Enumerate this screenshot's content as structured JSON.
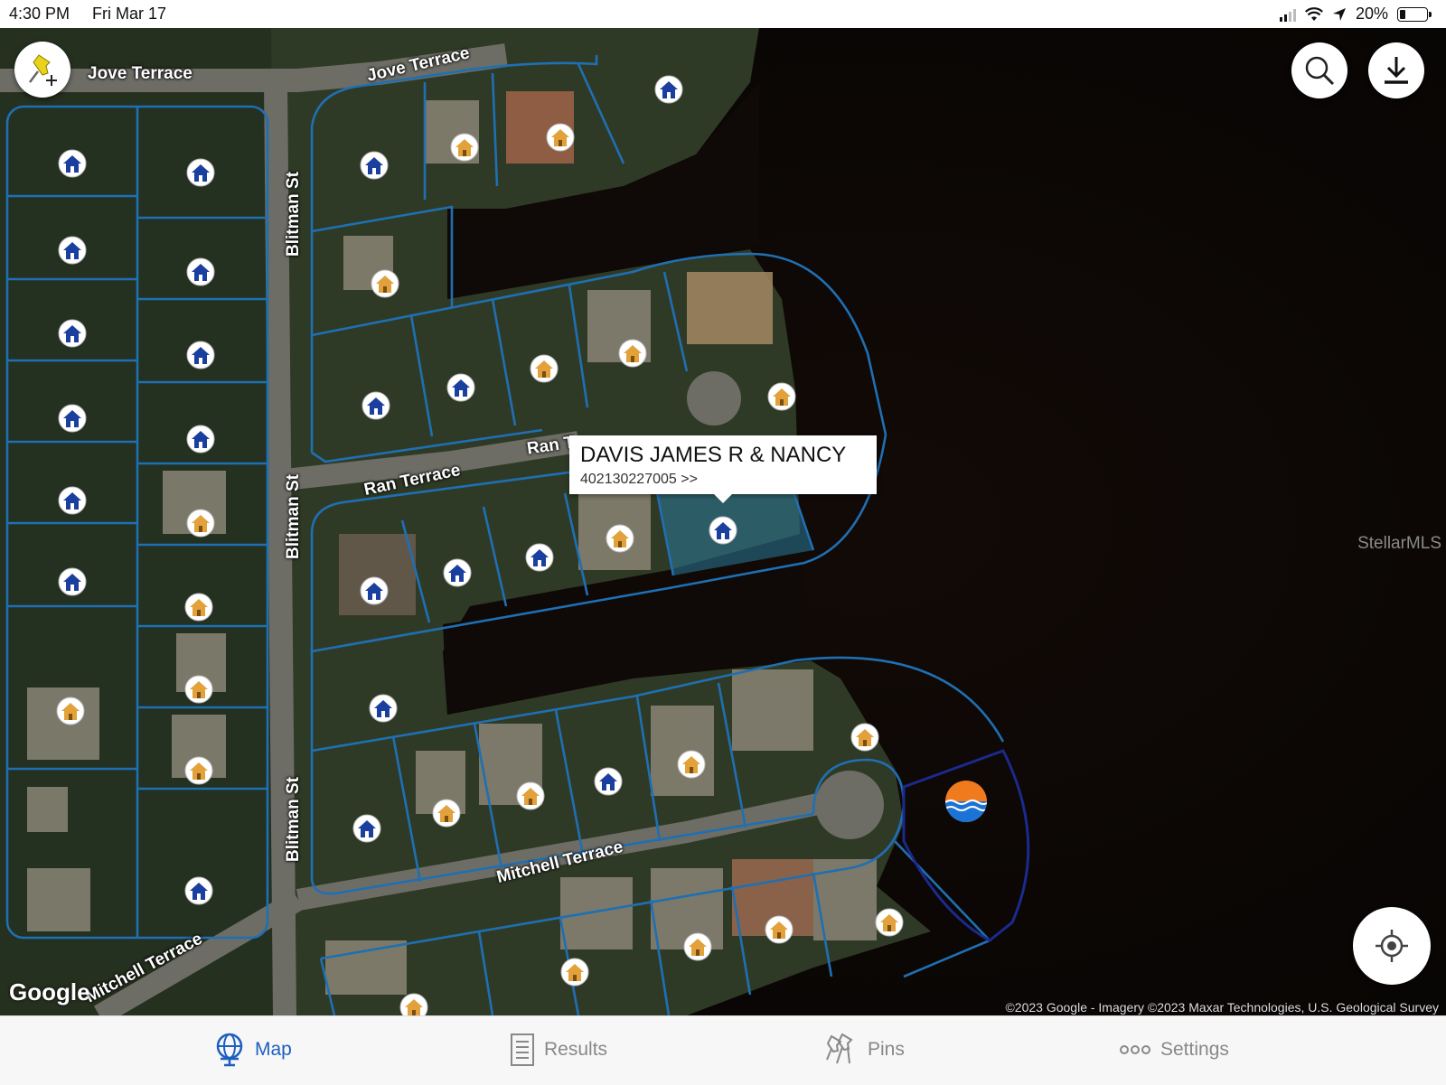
{
  "status_bar": {
    "time": "4:30 PM",
    "date": "Fri Mar 17",
    "battery": "20%"
  },
  "map": {
    "roads": {
      "jove_terrace_left": "Jove Terrace",
      "jove_terrace_right": "Jove Terrace",
      "blitman_st_top": "Blitman St",
      "blitman_st_mid": "Blitman St",
      "blitman_st_bottom": "Blitman St",
      "ran_terrace": "Ran Terrace",
      "ran_t": "Ran T",
      "mitchell_terrace_mid": "Mitchell Terrace",
      "mitchell_terrace_bottom": "Mitchell Terrace"
    },
    "selected_parcel": {
      "owner": "DAVIS JAMES R & NANCY",
      "parcel_link": "402130227005 >>"
    },
    "watermark": "StellarMLS",
    "google_logo": "Google",
    "attribution": "©2023 Google - Imagery ©2023 Maxar Technologies, U.S. Geological Survey"
  },
  "colors": {
    "parcel_line": "#1f6fb3",
    "tab_active": "#1d5fbf",
    "tab_inactive": "#888888",
    "selected_fill": "#2a7a9a"
  },
  "icons": {
    "add_pin": "pushpin-plus-icon",
    "search": "magnifier-icon",
    "download": "download-arrow-icon",
    "locate": "crosshair-icon",
    "water": "water-waves-icon"
  },
  "tabs": [
    {
      "label": "Map",
      "icon": "globe-icon",
      "active": true
    },
    {
      "label": "Results",
      "icon": "list-document-icon",
      "active": false
    },
    {
      "label": "Pins",
      "icon": "pins-icon",
      "active": false
    },
    {
      "label": "Settings",
      "icon": "ellipsis-icon",
      "active": false
    }
  ]
}
